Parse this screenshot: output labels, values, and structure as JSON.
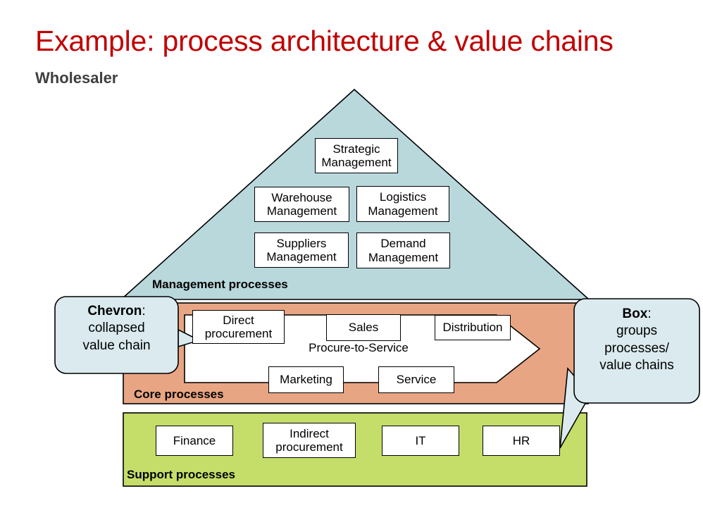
{
  "slide": {
    "title": "Example: process architecture & value chains",
    "subtitle": "Wholesaler",
    "title_color": "#c00000",
    "subtitle_color": "#3f3f3f",
    "background": "#ffffff"
  },
  "colors": {
    "pyramid_fill": "#b8d8dc",
    "core_band_fill": "#e8a583",
    "support_band_fill": "#c5de6a",
    "callout_fill": "#daeaee",
    "box_fill": "#ffffff",
    "outline": "#000000"
  },
  "management": {
    "caption": "Management processes",
    "boxes": [
      {
        "label": "Strategic\nManagement",
        "line1": "Strategic",
        "line2": "Management"
      },
      {
        "label": "Warehouse\nManagement",
        "line1": "Warehouse",
        "line2": "Management"
      },
      {
        "label": "Logistics\nManagement",
        "line1": "Logistics",
        "line2": "Management"
      },
      {
        "label": "Suppliers\nManagement",
        "line1": "Suppliers",
        "line2": "Management"
      },
      {
        "label": "Demand\nManagement",
        "line1": "Demand",
        "line2": "Management"
      }
    ]
  },
  "core": {
    "caption": "Core processes",
    "chain_label": "Procure-to-Service",
    "boxes": [
      {
        "line1": "Direct",
        "line2": "procurement"
      },
      {
        "line1": "Sales",
        "line2": ""
      },
      {
        "line1": "Distribution",
        "line2": ""
      },
      {
        "line1": "Marketing",
        "line2": ""
      },
      {
        "line1": "Service",
        "line2": ""
      }
    ]
  },
  "support": {
    "caption": "Support processes",
    "boxes": [
      {
        "line1": "Finance",
        "line2": ""
      },
      {
        "line1": "Indirect",
        "line2": "procurement"
      },
      {
        "line1": "IT",
        "line2": ""
      },
      {
        "line1": "HR",
        "line2": ""
      }
    ]
  },
  "callouts": {
    "left": {
      "heading": "Chevron",
      "colon": ":",
      "line2": "collapsed",
      "line3": "value chain"
    },
    "right": {
      "heading": "Box",
      "colon": ":",
      "line2": "groups",
      "line3": "processes/",
      "line4": "value chains"
    }
  }
}
